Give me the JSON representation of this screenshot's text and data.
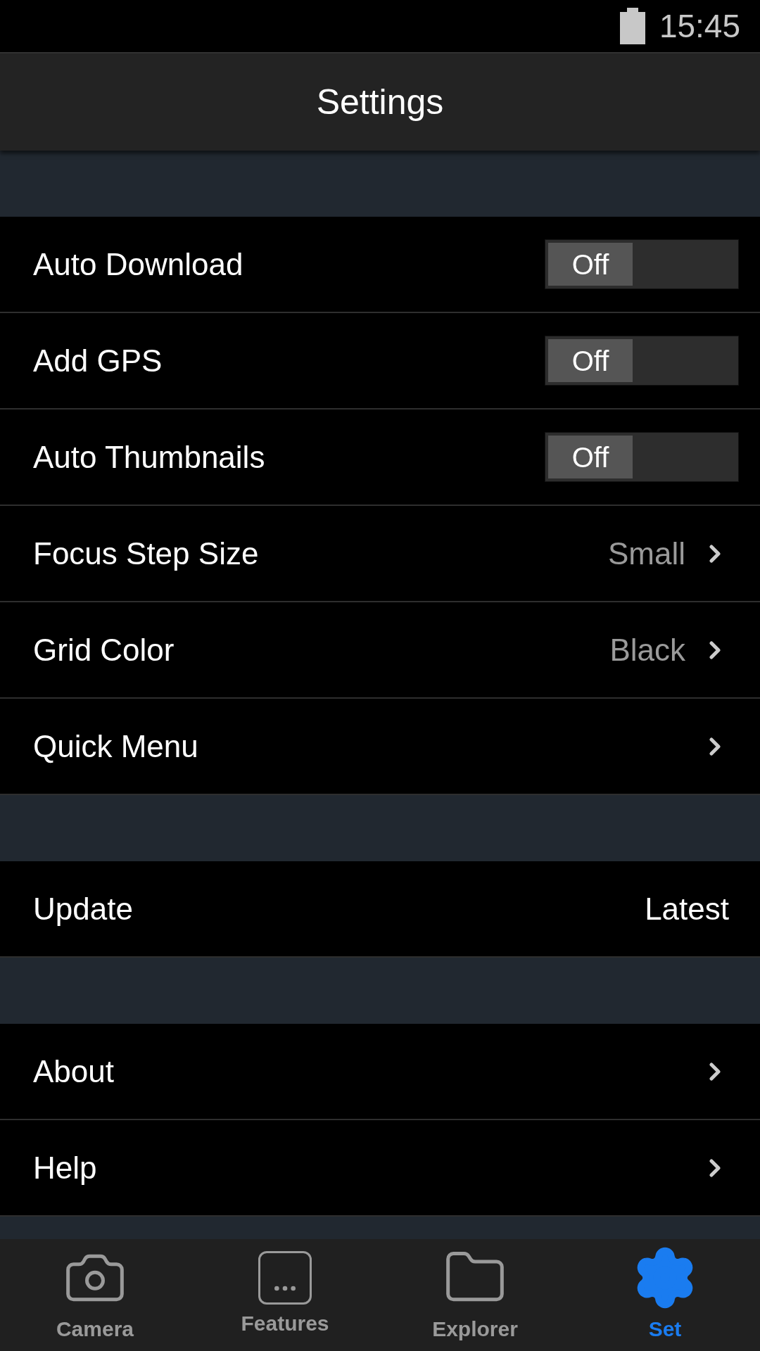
{
  "status_bar": {
    "time": "15:45"
  },
  "header": {
    "title": "Settings"
  },
  "sections": [
    {
      "rows": [
        {
          "kind": "toggle",
          "label": "Auto Download",
          "on": false,
          "state_label": "Off"
        },
        {
          "kind": "toggle",
          "label": "Add GPS",
          "on": false,
          "state_label": "Off"
        },
        {
          "kind": "toggle",
          "label": "Auto Thumbnails",
          "on": false,
          "state_label": "Off"
        },
        {
          "kind": "link",
          "label": "Focus Step Size",
          "value": "Small"
        },
        {
          "kind": "link",
          "label": "Grid Color",
          "value": "Black"
        },
        {
          "kind": "link",
          "label": "Quick Menu"
        }
      ]
    },
    {
      "rows": [
        {
          "kind": "info",
          "label": "Update",
          "value": "Latest"
        }
      ]
    },
    {
      "rows": [
        {
          "kind": "link",
          "label": "About"
        },
        {
          "kind": "link",
          "label": "Help"
        }
      ]
    }
  ],
  "tab_bar": [
    {
      "kind": "camera",
      "label": "Camera",
      "selected": false
    },
    {
      "kind": "features",
      "label": "Features",
      "selected": false
    },
    {
      "kind": "folder",
      "label": "Explorer",
      "selected": false
    },
    {
      "kind": "gear",
      "label": "Set",
      "selected": true
    }
  ]
}
